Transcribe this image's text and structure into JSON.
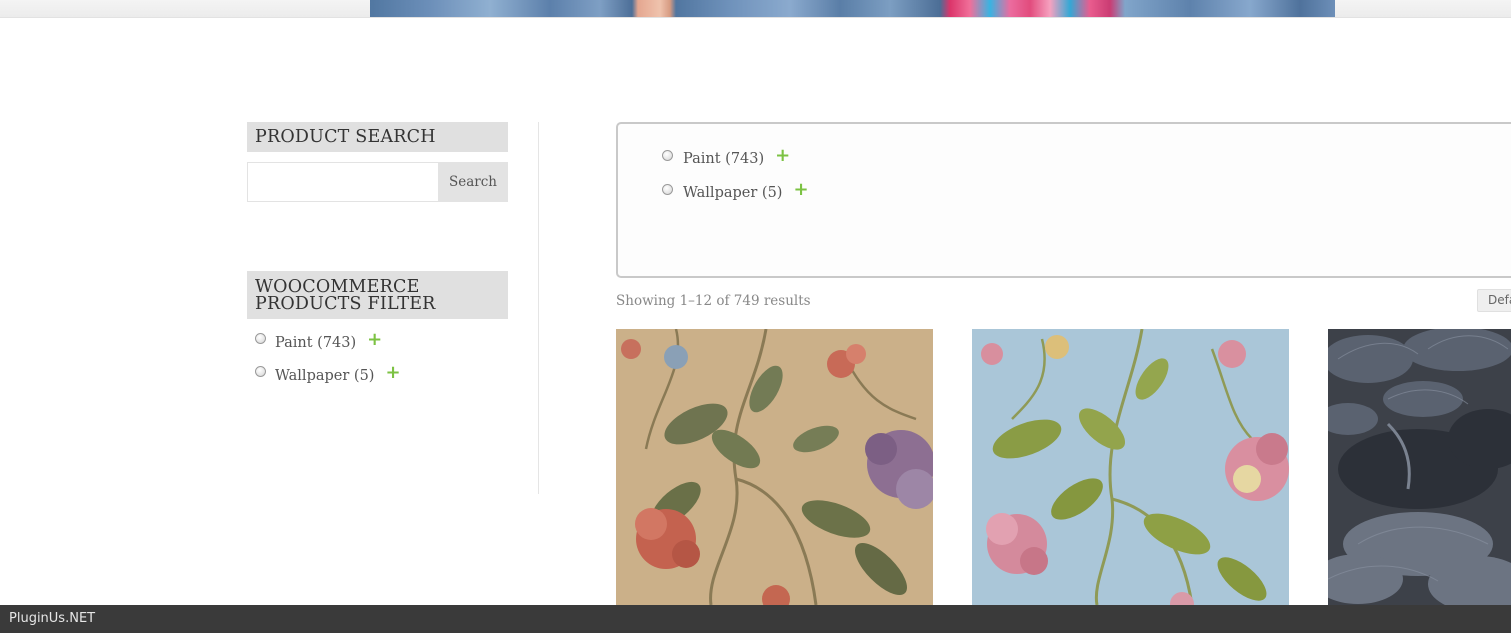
{
  "sidebar": {
    "product_search": {
      "title": "PRODUCT SEARCH",
      "input_value": "",
      "button_label": "Search"
    },
    "products_filter": {
      "title_line1": "WOOCOMMERCE",
      "title_line2": "PRODUCTS FILTER",
      "terms": [
        {
          "label": "Paint",
          "count": "(743)"
        },
        {
          "label": "Wallpaper",
          "count": "(5)"
        }
      ]
    }
  },
  "main": {
    "filter": {
      "terms": [
        {
          "label": "Paint",
          "count": "(743)"
        },
        {
          "label": "Wallpaper",
          "count": "(5)"
        }
      ]
    },
    "result_count": "Showing 1–12 of 749 results",
    "orderby_label": "Defa",
    "products": [
      {
        "image": "floral-wallpaper-beige-image"
      },
      {
        "image": "floral-wallpaper-blue-image"
      },
      {
        "image": "dark-pine-wallpaper-image"
      }
    ]
  },
  "footer": {
    "brand": "PluginUs.NET"
  },
  "colors": {
    "plus_accent": "#7cc243",
    "widget_title_bg": "#e0e0e0",
    "footer_bg": "#3a3a3a"
  }
}
